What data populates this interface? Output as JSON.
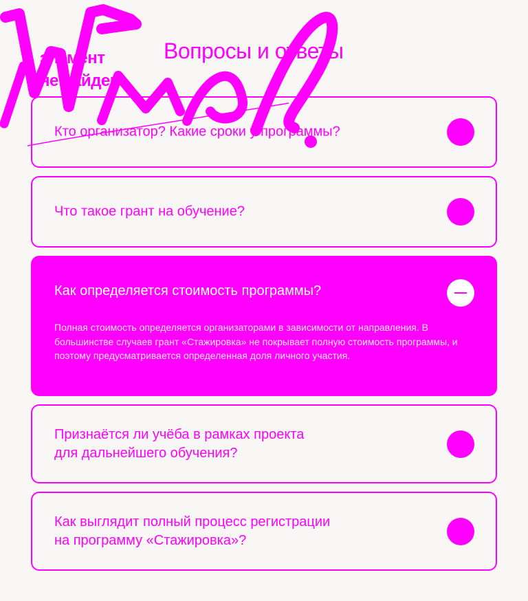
{
  "page": {
    "title": "Вопросы и ответы",
    "not_found": "элемент\nне найден"
  },
  "colors": {
    "accent": "#ff00ff",
    "background": "#f8f7f6",
    "on_accent": "#ffffff"
  },
  "faq": [
    {
      "question": "Кто организатор? Какие сроки у программы?",
      "expanded": false,
      "icon": "toggle-icon"
    },
    {
      "question": "Что такое грант на обучение?",
      "expanded": false,
      "icon": "toggle-icon"
    },
    {
      "question": "Как определяется стоимость программы?",
      "expanded": true,
      "icon": "minus-icon",
      "answer": "Полная стоимость определяется организаторами в зависимости от направления. В большинстве случаев грант «Стажировка» не покрывает полную стоимость программы, и поэтому предусматривается определенная доля личного участия."
    },
    {
      "question": "Признаётся ли учёба в рамках проекта\nдля дальнейшего обучения?",
      "expanded": false,
      "icon": "toggle-icon"
    },
    {
      "question": "Как выглядит полный процесс регистрации\nна программу «Стажировка»?",
      "expanded": false,
      "icon": "toggle-icon"
    }
  ]
}
